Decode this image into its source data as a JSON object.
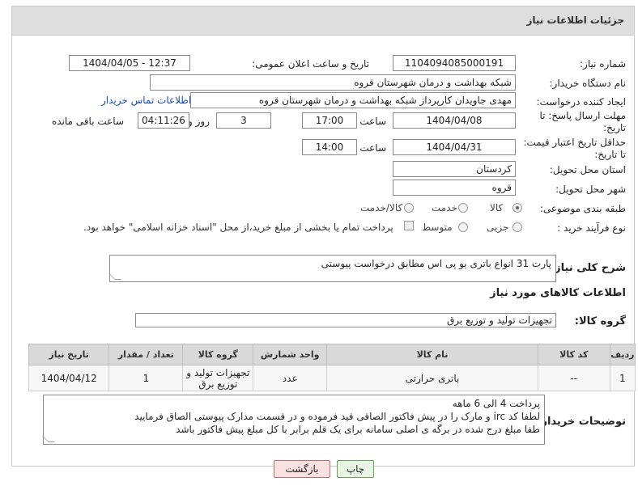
{
  "header": {
    "title": "جزئیات اطلاعات نیاز"
  },
  "fields": {
    "need_number": {
      "label": "شماره نیاز:",
      "value": "1104094085000191"
    },
    "announce_datetime": {
      "label": "تاریخ و ساعت اعلان عمومی:",
      "value": "1404/04/05 - 12:37"
    },
    "buyer_org": {
      "label": "نام دستگاه خریدار:",
      "value": "شبکه بهداشت و درمان شهرستان قروه"
    },
    "requester": {
      "label": "ایجاد کننده درخواست:",
      "value": "مهدی جاویدان کارپرداز شبکه بهداشت و درمان شهرستان قروه",
      "contact_link": "اطلاعات تماس خریدار"
    },
    "deadline": {
      "label": "مهلت ارسال پاسخ: تا تاریخ:",
      "date": "1404/04/08",
      "time_label": "ساعت",
      "time": "17:00",
      "days": "3",
      "days_label": "روز و",
      "remaining": "04:11:26",
      "remaining_label": "ساعت باقی مانده"
    },
    "price_validity": {
      "label": "حداقل تاریخ اعتبار قیمت: تا تاریخ:",
      "date": "1404/04/31",
      "time_label": "ساعت",
      "time": "14:00"
    },
    "delivery_province": {
      "label": "استان محل تحویل:",
      "value": "کردستان"
    },
    "delivery_city": {
      "label": "شهر محل تحویل:",
      "value": "قروه"
    },
    "category": {
      "label": "طبقه بندی موضوعی:",
      "options": [
        "کالا",
        "خدمت",
        "کالا/خدمت"
      ],
      "selected": "کالا"
    },
    "purchase_type": {
      "label": "نوع فرآیند خرید :",
      "options": [
        "جزیی",
        "متوسط"
      ],
      "payment_note": "پرداخت تمام یا بخشی از مبلغ خرید،از محل \"اسناد خزانه اسلامی\" خواهد بود."
    }
  },
  "description": {
    "label": "شرح کلی نیاز:",
    "value": "پارت 31 انواع باتری یو پی اس مطابق درخواست پیوستی"
  },
  "goods_section": {
    "title": "اطلاعات کالاهای مورد نیاز"
  },
  "goods_group": {
    "label": "گروه کالا:",
    "value": "تجهیزات تولید و توزیع برق"
  },
  "table": {
    "headers": [
      "ردیف",
      "کد کالا",
      "نام کالا",
      "واحد شمارش",
      "گروه کالا",
      "تعداد / مقدار",
      "تاریخ نیاز"
    ],
    "rows": [
      [
        "1",
        "--",
        "باتری حرارتی",
        "عدد",
        "تجهیزات تولید و توزیع برق",
        "1",
        "1404/04/12"
      ]
    ]
  },
  "buyer_notes": {
    "label": "توضیحات خریدار:",
    "lines": [
      "پرداخت 4 الی 6 ماهه",
      "لطفا کد irc  و مارک را در پیش فاکتور الصاقی قید فرموده و در قسمت مدارک پیوستی الصاق فرمایید",
      "طفا مبلغ درج شده در برگه ی اصلی سامانه برای یک قلم برابر با کل مبلغ پیش فاکتور باشد"
    ]
  },
  "buttons": {
    "print": "چاپ",
    "back": "بازگشت"
  },
  "colors": {
    "header_bg": "#dedede",
    "link": "#1a4fb5",
    "print_bg": "#e9f5e4",
    "back_bg": "#f9e1e1"
  }
}
